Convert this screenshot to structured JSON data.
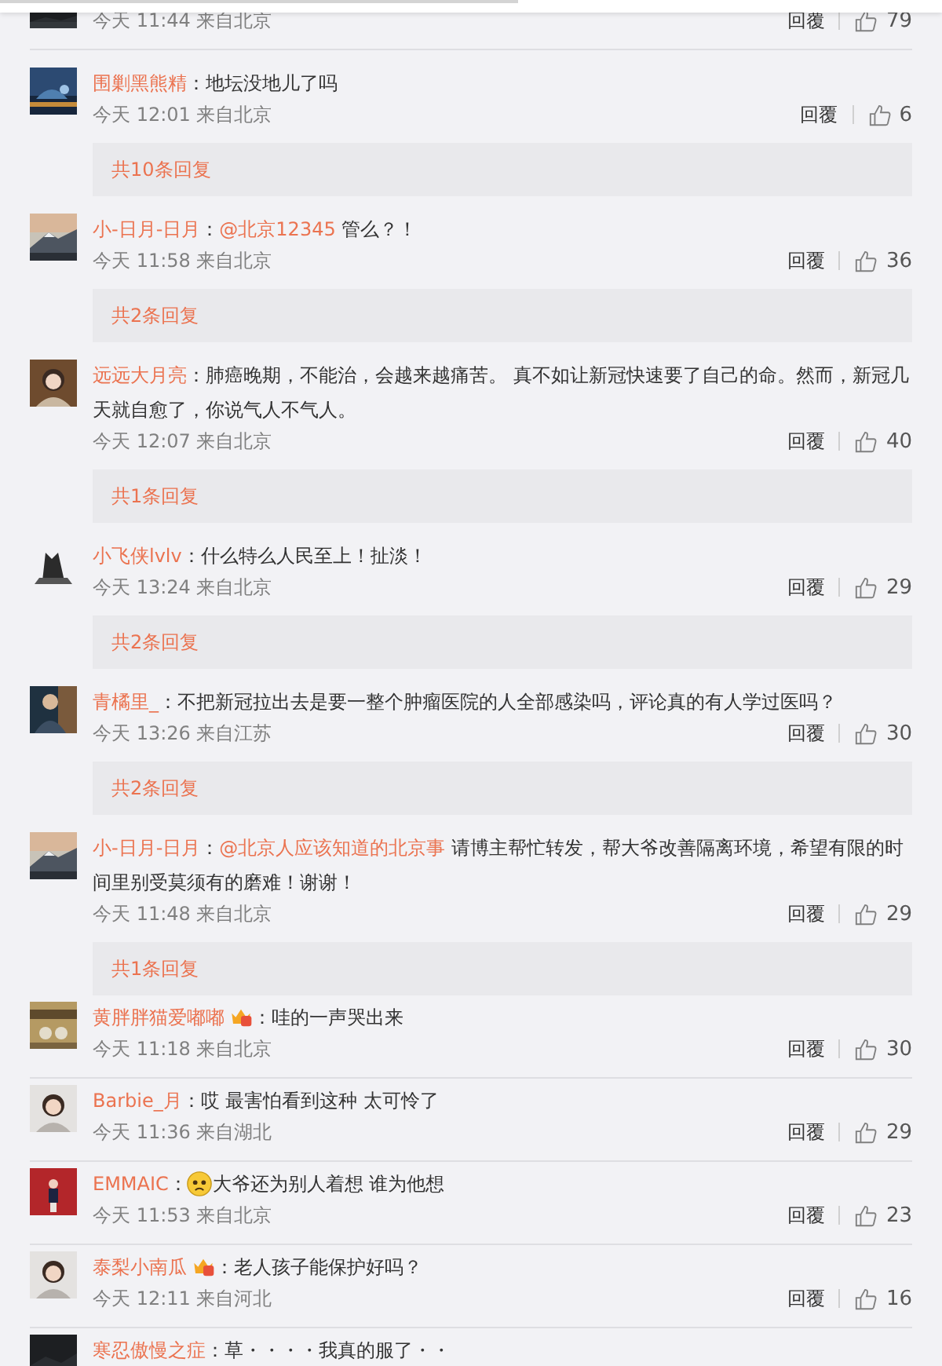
{
  "comments": [
    {
      "time": "今天 11:44 来自北京",
      "reply": "回覆",
      "likes": "79"
    },
    {
      "username": "围剿黑熊精",
      "body": [
        {
          "kind": "text",
          "text": "：地坛没地儿了吗"
        }
      ],
      "time": "今天 12:01 来自北京",
      "reply": "回覆",
      "likes": "6",
      "replies": "共10条回复"
    },
    {
      "username": "小-日月-日月",
      "body": [
        {
          "kind": "text",
          "text": "："
        },
        {
          "kind": "mention",
          "text": "@北京12345"
        },
        {
          "kind": "text",
          "text": " 管么？！"
        }
      ],
      "time": "今天 11:58 来自北京",
      "reply": "回覆",
      "likes": "36",
      "replies": "共2条回复"
    },
    {
      "username": "远远大月亮",
      "body": [
        {
          "kind": "text",
          "text": "：肺癌晚期，不能治，会越来越痛苦。 真不如让新冠快速要了自己的命。然而，新冠几天就自愈了，你说气人不气人。"
        }
      ],
      "time": "今天 12:07 来自北京",
      "reply": "回覆",
      "likes": "40",
      "replies": "共1条回复"
    },
    {
      "username": "小飞侠lvlv",
      "body": [
        {
          "kind": "text",
          "text": "：什么特么人民至上！扯淡！"
        }
      ],
      "time": "今天 13:24 来自北京",
      "reply": "回覆",
      "likes": "29",
      "replies": "共2条回复"
    },
    {
      "username": "青橘里_",
      "body": [
        {
          "kind": "text",
          "text": "：不把新冠拉出去是要一整个肿瘤医院的人全部感染吗，评论真的有人学过医吗？"
        }
      ],
      "time": "今天 13:26 来自江苏",
      "reply": "回覆",
      "likes": "30",
      "replies": "共2条回复"
    },
    {
      "username": "小-日月-日月",
      "body": [
        {
          "kind": "text",
          "text": "："
        },
        {
          "kind": "mention",
          "text": "@北京人应该知道的北京事"
        },
        {
          "kind": "text",
          "text": " 请博主帮忙转发，帮大爷改善隔离环境，希望有限的时间里别受莫须有的磨难！谢谢！"
        }
      ],
      "time": "今天 11:48 来自北京",
      "reply": "回覆",
      "likes": "29",
      "replies": "共1条回复"
    },
    {
      "username": "黄胖胖猫爱嘟嘟",
      "badge": true,
      "body": [
        {
          "kind": "text",
          "text": "：哇的一声哭出来"
        }
      ],
      "time": "今天 11:18 来自北京",
      "reply": "回覆",
      "likes": "30"
    },
    {
      "username": "Barbie_月",
      "body": [
        {
          "kind": "text",
          "text": "：哎 最害怕看到这种 太可怜了"
        }
      ],
      "time": "今天 11:36 来自湖北",
      "reply": "回覆",
      "likes": "29"
    },
    {
      "username": "EMMAIC",
      "body": [
        {
          "kind": "text",
          "text": "："
        },
        {
          "kind": "emoji"
        },
        {
          "kind": "text",
          "text": "大爷还为别人着想 谁为他想"
        }
      ],
      "time": "今天 11:53 来自北京",
      "reply": "回覆",
      "likes": "23"
    },
    {
      "username": "泰梨小南瓜",
      "badge": true,
      "body": [
        {
          "kind": "text",
          "text": "：老人孩子能保护好吗？"
        }
      ],
      "time": "今天 12:11 来自河北",
      "reply": "回覆",
      "likes": "16"
    },
    {
      "username": "寒忍傲慢之症",
      "body": [
        {
          "kind": "text",
          "text": "：草・・・・我真的服了・・"
        }
      ]
    }
  ]
}
